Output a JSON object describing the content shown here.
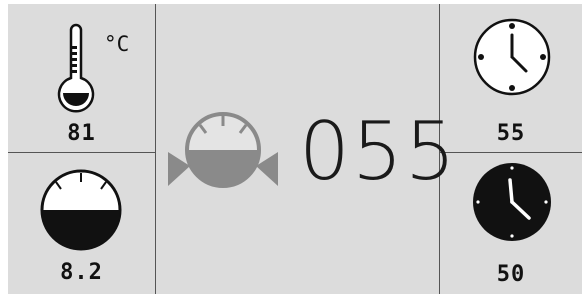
{
  "temperature": {
    "unit": "°C",
    "value": "81",
    "icon": "thermometer-icon"
  },
  "level_gauge": {
    "value": "8.2",
    "icon": "half-filled-gauge-icon",
    "fill": 0.5
  },
  "center": {
    "value": "055",
    "icon": "gauge-with-arrows-icon"
  },
  "clock_top": {
    "value": "55",
    "icon": "clock-outline-icon"
  },
  "clock_bottom": {
    "value": "50",
    "icon": "clock-filled-icon"
  },
  "colors": {
    "background": "#dcdcdc",
    "foreground": "#111111",
    "gauge_gray": "#8a8a8a"
  }
}
